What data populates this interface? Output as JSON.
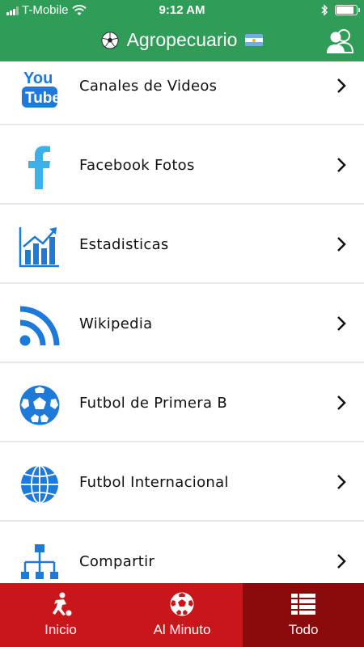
{
  "status_bar": {
    "carrier": "T-Mobile",
    "time": "9:12 AM",
    "battery_level": 0.9
  },
  "header": {
    "title": "Agropecuario",
    "users_icon": "users-icon"
  },
  "list": {
    "items": [
      {
        "label": "Canales de Videos",
        "icon": "youtube-icon"
      },
      {
        "label": "Facebook Fotos",
        "icon": "facebook-icon"
      },
      {
        "label": "Estadisticas",
        "icon": "chart-icon"
      },
      {
        "label": "Wikipedia",
        "icon": "rss-icon"
      },
      {
        "label": "Futbol de Primera B",
        "icon": "soccer-ball-icon"
      },
      {
        "label": "Futbol Internacional",
        "icon": "globe-icon"
      },
      {
        "label": "Compartir",
        "icon": "share-icon"
      }
    ]
  },
  "tabbar": {
    "tabs": [
      {
        "label": "Inicio",
        "icon": "player-icon"
      },
      {
        "label": "Al Minuto",
        "icon": "soccer-ball-icon"
      },
      {
        "label": "Todo",
        "icon": "list-icon",
        "active": true
      }
    ]
  },
  "colors": {
    "header_green": "#2f9c57",
    "tab_red": "#c8161a",
    "tab_active": "#8b0a0c",
    "icon_blue": "#1e7ad9",
    "facebook_blue": "#3db0e8"
  }
}
